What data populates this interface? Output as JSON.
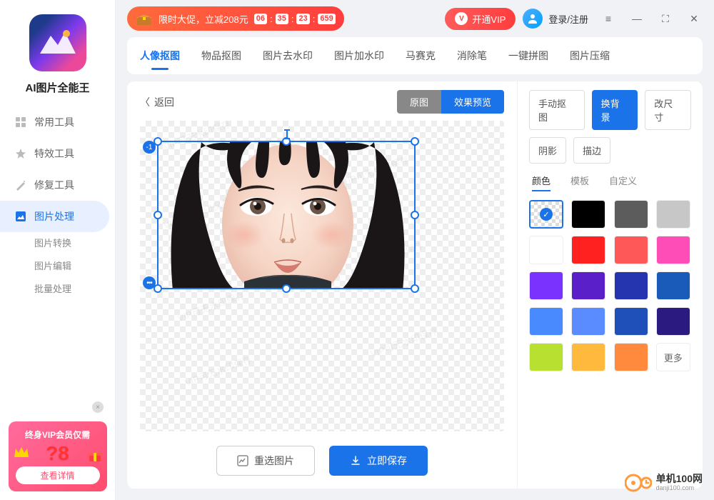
{
  "app": {
    "title": "AI图片全能王"
  },
  "sidebar": {
    "items": [
      {
        "label": "常用工具"
      },
      {
        "label": "特效工具"
      },
      {
        "label": "修复工具"
      },
      {
        "label": "图片处理",
        "active": true
      },
      {
        "label": "图片转换"
      },
      {
        "label": "图片编辑"
      },
      {
        "label": "批量处理"
      }
    ]
  },
  "vipCard": {
    "title": "终身VIP会员仅需",
    "price": "?8",
    "btn": "查看详情"
  },
  "topbar": {
    "promoText": "限时大促，立减208元",
    "countdown": [
      "06",
      "35",
      "23",
      "659"
    ],
    "vipBtn": "开通VIP",
    "login": "登录/注册"
  },
  "tabs": [
    "人像抠图",
    "物品抠图",
    "图片去水印",
    "图片加水印",
    "马赛克",
    "消除笔",
    "一键拼图",
    "图片压缩"
  ],
  "canvas": {
    "back": "返回",
    "original": "原图",
    "preview": "效果预览",
    "selBadge": "-1",
    "watermark": "VIP可无水印保存",
    "reupload": "重选图片",
    "save": "立即保存"
  },
  "panel": {
    "row1": [
      "手动抠图",
      "换背景",
      "改尺寸"
    ],
    "row2": [
      "阴影",
      "描边"
    ],
    "bgTabs": [
      "颜色",
      "模板",
      "自定义"
    ],
    "colors": [
      "transparent",
      "#000000",
      "#5c5c5c",
      "#c7c7c7",
      "#ffffff",
      "#ff2020",
      "#ff5858",
      "#ff4db8",
      "#7a33ff",
      "#5a1fc9",
      "#2535b0",
      "#1a5ab8",
      "#4a8aff",
      "#5a8bff",
      "#1f4fb8",
      "#2b1b80",
      "#b8e030",
      "#ffb93d",
      "#ff8a3d"
    ],
    "more": "更多"
  },
  "brand": {
    "name": "单机100网",
    "url": "danji100.com"
  }
}
